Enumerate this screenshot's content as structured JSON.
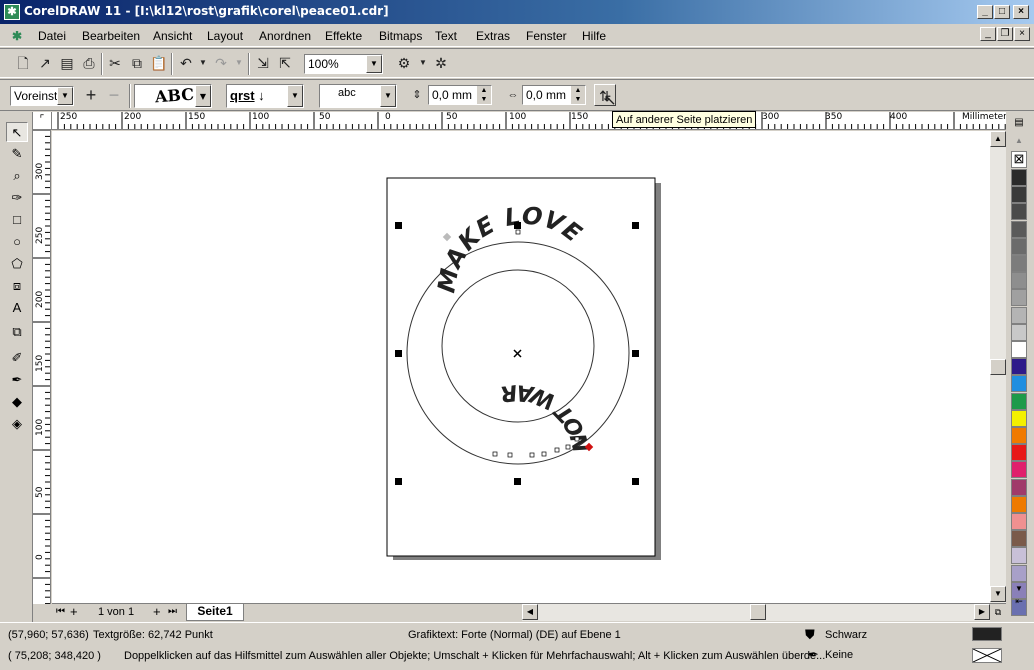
{
  "window": {
    "title": "CorelDRAW 11 - [I:\\kl12\\rost\\grafik\\corel\\peace01.cdr]"
  },
  "menu": [
    "Datei",
    "Bearbeiten",
    "Ansicht",
    "Layout",
    "Anordnen",
    "Effekte",
    "Bitmaps",
    "Text",
    "Extras",
    "Fenster",
    "Hilfe"
  ],
  "toolbar": {
    "zoom": "100%"
  },
  "property_bar": {
    "preset": "Voreinste",
    "text_orientation_sample": "ABC",
    "vertical_placement_sample": "qrst",
    "text_placement_sample": "abc",
    "distance_from_path": "0,0 mm",
    "horizontal_offset": "0,0 mm"
  },
  "tooltip": "Auf anderer Seite platzieren",
  "rulers": {
    "unit": "Millimeter",
    "h_labels": [
      "250",
      "200",
      "150",
      "100",
      "50",
      "0",
      "50",
      "100",
      "150",
      "300",
      "350",
      "400"
    ],
    "v_labels": [
      "300",
      "250",
      "200",
      "150",
      "100",
      "50",
      "0"
    ]
  },
  "artwork": {
    "top_text": "MAKE LOVE",
    "bottom_text": "NOT WAR"
  },
  "pages": {
    "counter": "1 von 1",
    "tab": "Seite1"
  },
  "status": {
    "cursor": "(57,960; 57,636)",
    "text_size": "Textgröße: 62,742 Punkt",
    "object_info": "Grafiktext: Forte (Normal) (DE) auf Ebene 1",
    "fill_label": "Schwarz",
    "outline_label": "Keine",
    "cursor2": "( 75,208; 348,420 )",
    "hint": "Doppelklicken auf das Hilfsmittel zum Auswählen aller Objekte; Umschalt + Klicken für Mehrfachauswahl; Alt + Klicken zum Auswählen überde..."
  },
  "palette": [
    "#2b2b2b",
    "#3a3a3a",
    "#4a4a4a",
    "#5a5a5a",
    "#6b6b6b",
    "#7c7c7c",
    "#8e8e8e",
    "#a0a0a0",
    "#b4b4b4",
    "#c8c8c8",
    "#ffffff",
    "#2e1a8a",
    "#1f8ee0",
    "#1e9a4a",
    "#f4f000",
    "#f07a00",
    "#e81818",
    "#e0206c",
    "#a03a6a",
    "#ee7a00",
    "#f09090",
    "#7a5a4a",
    "#c8c0d8",
    "#a8a0c8",
    "#8a80b8",
    "#6a70b0"
  ]
}
